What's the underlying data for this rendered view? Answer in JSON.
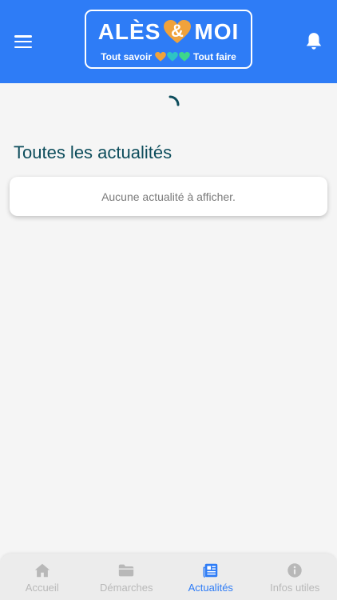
{
  "header": {
    "logo_title_left": "ALÈS",
    "logo_amp": "&",
    "logo_title_right": "MOI",
    "logo_sub_left": "Tout savoir",
    "logo_sub_right": "Tout faire"
  },
  "main": {
    "section_title": "Toutes les actualités",
    "empty_message": "Aucune actualité à afficher."
  },
  "tabs": [
    {
      "label": "Accueil",
      "icon": "home-icon",
      "active": false
    },
    {
      "label": "Démarches",
      "icon": "folder-icon",
      "active": false
    },
    {
      "label": "Actualités",
      "icon": "newspaper-icon",
      "active": true
    },
    {
      "label": "Infos utiles",
      "icon": "info-icon",
      "active": false
    }
  ],
  "colors": {
    "header_blue": "#2e7cf6",
    "title_teal": "#0d4d5c",
    "heart_orange": "#f0a23b",
    "heart_teal": "#2ec4c4",
    "heart_green": "#3dd68c",
    "tab_inactive": "#b8b8b8"
  }
}
